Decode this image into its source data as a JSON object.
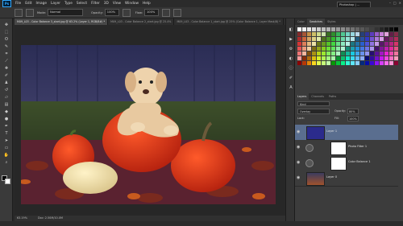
{
  "app": {
    "logo": "Ps",
    "workspace": "Photoshop | ..."
  },
  "menu": [
    "File",
    "Edit",
    "Image",
    "Layer",
    "Type",
    "Select",
    "Filter",
    "3D",
    "View",
    "Window",
    "Help"
  ],
  "options": {
    "mode_label": "Mode:",
    "mode_value": "Normal",
    "opacity_label": "Opacity:",
    "opacity_value": "100%",
    "flow_label": "Flow:",
    "flow_value": "100%"
  },
  "tabs": [
    {
      "label": "M09_L03 - Color Balance 3_start.jpg @ 63.2% (Layer 1, RGB/8#) *",
      "active": true
    },
    {
      "label": "M09_L03 - Color Balance 2_start.jpg @ 25.4%",
      "active": false
    },
    {
      "label": "M09_L03 - Color Balance 1_start.jpg @ 25% (Color Balance 1, Layer Mask/8) *",
      "active": false
    }
  ],
  "status": {
    "zoom": "63.19%",
    "doc": "Doc: 2.50M/10.0M"
  },
  "swatch_panel": {
    "tabs": [
      "Color",
      "Swatches",
      "Styles"
    ]
  },
  "layers_panel": {
    "tabs": [
      "Layers",
      "Channels",
      "Paths"
    ],
    "kind_label": "Kind",
    "blend_mode": "Overlay",
    "opacity_label": "Opacity:",
    "opacity_value": "80%",
    "lock_label": "Lock:",
    "fill_label": "Fill:",
    "fill_value": "100%",
    "layers": [
      {
        "name": "Layer 1",
        "selected": true,
        "type": "fill",
        "color": "#2b2b8c"
      },
      {
        "name": "Photo Filter 1",
        "selected": false,
        "type": "adjustment",
        "color": "#ffffff"
      },
      {
        "name": "Color Balance 1",
        "selected": false,
        "type": "adjustment",
        "color": "#ffffff"
      },
      {
        "name": "Layer 0",
        "selected": false,
        "type": "image",
        "color": "#a0522d"
      }
    ]
  },
  "colors": {
    "accent_selected": "#5a6e8f",
    "ps_blue": "#31a8ff"
  },
  "icons": {
    "eye": "eye-icon",
    "tools": [
      "move-tool-icon",
      "marquee-tool-icon",
      "lasso-tool-icon",
      "quick-select-icon",
      "crop-tool-icon",
      "eyedropper-icon",
      "healing-brush-icon",
      "brush-tool-icon",
      "clone-stamp-icon",
      "history-brush-icon",
      "eraser-icon",
      "gradient-tool-icon",
      "blur-tool-icon",
      "dodge-tool-icon",
      "pen-tool-icon",
      "type-tool-icon",
      "path-select-icon",
      "shape-tool-icon",
      "hand-tool-icon",
      "zoom-tool-icon"
    ]
  }
}
